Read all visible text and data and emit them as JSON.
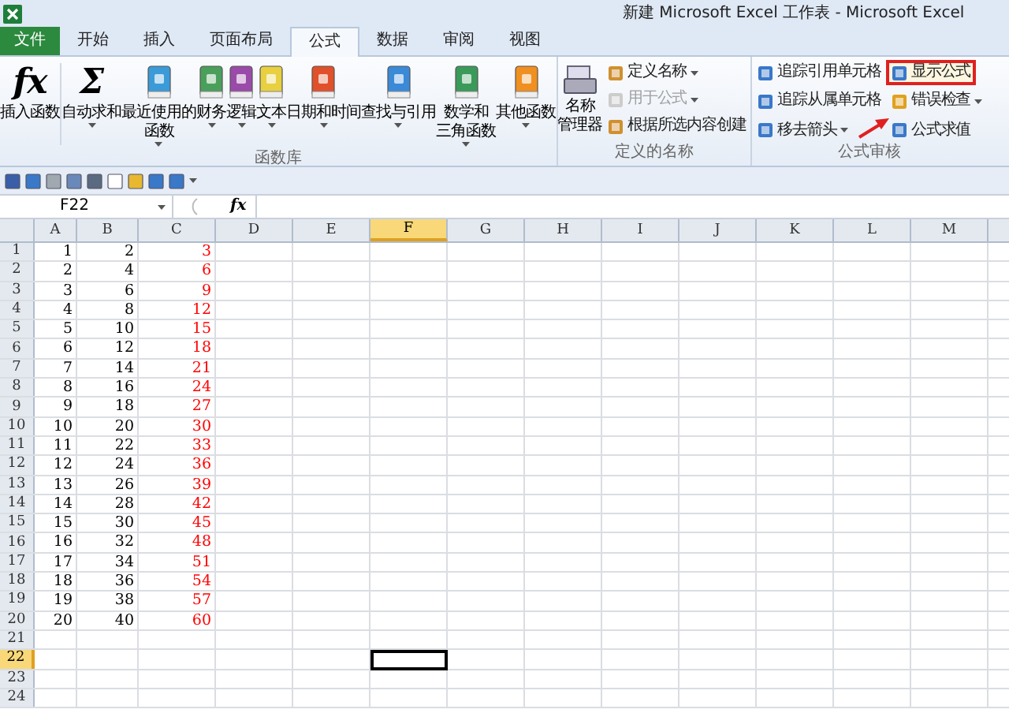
{
  "window": {
    "title": "新建 Microsoft Excel 工作表 - Microsoft Excel"
  },
  "tabs": [
    {
      "label": "文件",
      "kind": "file",
      "selected": false
    },
    {
      "label": "开始",
      "kind": "tab",
      "selected": false
    },
    {
      "label": "插入",
      "kind": "tab",
      "selected": false
    },
    {
      "label": "页面布局",
      "kind": "tab",
      "selected": false
    },
    {
      "label": "公式",
      "kind": "tab",
      "selected": true
    },
    {
      "label": "数据",
      "kind": "tab",
      "selected": false
    },
    {
      "label": "审阅",
      "kind": "tab",
      "selected": false
    },
    {
      "label": "视图",
      "kind": "tab",
      "selected": false
    }
  ],
  "ribbon": {
    "function_library": {
      "title": "函数库",
      "items": [
        {
          "kind": "glyph",
          "glyph": "fx",
          "lines": [
            "插入函数"
          ],
          "dropdown": false
        },
        {
          "kind": "glyph",
          "glyph": "Σ",
          "lines": [
            "自动求和"
          ],
          "dropdown": true
        },
        {
          "kind": "book",
          "lines": [
            "最近使用的",
            "函数"
          ],
          "dropdown": true
        },
        {
          "kind": "book",
          "lines": [
            "财务"
          ],
          "dropdown": true
        },
        {
          "kind": "book",
          "lines": [
            "逻辑"
          ],
          "dropdown": true
        },
        {
          "kind": "book",
          "lines": [
            "文本"
          ],
          "dropdown": true
        },
        {
          "kind": "book",
          "lines": [
            "日期和时间"
          ],
          "dropdown": true
        },
        {
          "kind": "book",
          "lines": [
            "查找与引用"
          ],
          "dropdown": true
        },
        {
          "kind": "book",
          "lines": [
            "数学和",
            "三角函数"
          ],
          "dropdown": true
        },
        {
          "kind": "book",
          "lines": [
            "其他函数"
          ],
          "dropdown": true
        }
      ]
    },
    "defined_names": {
      "title": "定义的名称",
      "manager": {
        "lines": [
          "名称",
          "管理器"
        ]
      },
      "items": [
        {
          "label": "定义名称",
          "dropdown": true,
          "disabled": false
        },
        {
          "label": "用于公式",
          "dropdown": true,
          "disabled": true
        },
        {
          "label": "根据所选内容创建",
          "dropdown": false,
          "disabled": false
        }
      ]
    },
    "formula_auditing": {
      "title": "公式审核",
      "items": [
        {
          "label": "追踪引用单元格",
          "dropdown": false,
          "highlighted": false
        },
        {
          "label": "显示公式",
          "dropdown": false,
          "highlighted": true
        },
        {
          "label": "追踪从属单元格",
          "dropdown": false,
          "highlighted": false
        },
        {
          "label": "错误检查",
          "dropdown": true,
          "highlighted": false
        },
        {
          "label": "移去箭头",
          "dropdown": true,
          "highlighted": false
        },
        {
          "label": "公式求值",
          "dropdown": false,
          "highlighted": false
        }
      ]
    }
  },
  "formula_bar": {
    "name_box": "F22",
    "fx": "fx"
  },
  "columns": [
    {
      "label": "A",
      "selected": false,
      "color": "#000000"
    },
    {
      "label": "B",
      "selected": false,
      "color": "#000000"
    },
    {
      "label": "C",
      "selected": false,
      "color": "#ff0000"
    },
    {
      "label": "D",
      "selected": false
    },
    {
      "label": "E",
      "selected": false
    },
    {
      "label": "F",
      "selected": true
    },
    {
      "label": "G",
      "selected": false
    },
    {
      "label": "H",
      "selected": false
    },
    {
      "label": "I",
      "selected": false
    },
    {
      "label": "J",
      "selected": false
    },
    {
      "label": "K",
      "selected": false
    },
    {
      "label": "L",
      "selected": false
    },
    {
      "label": "M",
      "selected": false
    }
  ],
  "rows": [
    {
      "label": "1",
      "selected": false,
      "cells": [
        "1",
        "2",
        "3"
      ]
    },
    {
      "label": "2",
      "selected": false,
      "cells": [
        "2",
        "4",
        "6"
      ]
    },
    {
      "label": "3",
      "selected": false,
      "cells": [
        "3",
        "6",
        "9"
      ]
    },
    {
      "label": "4",
      "selected": false,
      "cells": [
        "4",
        "8",
        "12"
      ]
    },
    {
      "label": "5",
      "selected": false,
      "cells": [
        "5",
        "10",
        "15"
      ]
    },
    {
      "label": "6",
      "selected": false,
      "cells": [
        "6",
        "12",
        "18"
      ]
    },
    {
      "label": "7",
      "selected": false,
      "cells": [
        "7",
        "14",
        "21"
      ]
    },
    {
      "label": "8",
      "selected": false,
      "cells": [
        "8",
        "16",
        "24"
      ]
    },
    {
      "label": "9",
      "selected": false,
      "cells": [
        "9",
        "18",
        "27"
      ]
    },
    {
      "label": "10",
      "selected": false,
      "cells": [
        "10",
        "20",
        "30"
      ]
    },
    {
      "label": "11",
      "selected": false,
      "cells": [
        "11",
        "22",
        "33"
      ]
    },
    {
      "label": "12",
      "selected": false,
      "cells": [
        "12",
        "24",
        "36"
      ]
    },
    {
      "label": "13",
      "selected": false,
      "cells": [
        "13",
        "26",
        "39"
      ]
    },
    {
      "label": "14",
      "selected": false,
      "cells": [
        "14",
        "28",
        "42"
      ]
    },
    {
      "label": "15",
      "selected": false,
      "cells": [
        "15",
        "30",
        "45"
      ]
    },
    {
      "label": "16",
      "selected": false,
      "cells": [
        "16",
        "32",
        "48"
      ]
    },
    {
      "label": "17",
      "selected": false,
      "cells": [
        "17",
        "34",
        "51"
      ]
    },
    {
      "label": "18",
      "selected": false,
      "cells": [
        "18",
        "36",
        "54"
      ]
    },
    {
      "label": "19",
      "selected": false,
      "cells": [
        "19",
        "38",
        "57"
      ]
    },
    {
      "label": "20",
      "selected": false,
      "cells": [
        "20",
        "40",
        "60"
      ]
    },
    {
      "label": "21",
      "selected": false,
      "cells": []
    },
    {
      "label": "22",
      "selected": true,
      "cells": []
    },
    {
      "label": "23",
      "selected": false,
      "cells": []
    },
    {
      "label": "24",
      "selected": false,
      "cells": []
    }
  ]
}
